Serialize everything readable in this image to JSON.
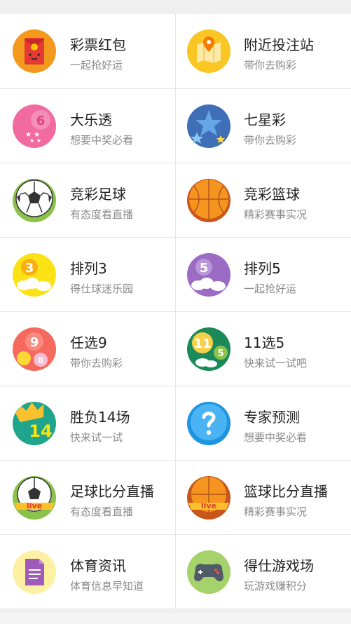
{
  "items": [
    {
      "title": "彩票红包",
      "subtitle": "一起抢好运",
      "icon": "red-envelope-icon"
    },
    {
      "title": "附近投注站",
      "subtitle": "带你去购彩",
      "icon": "map-pin-icon"
    },
    {
      "title": "大乐透",
      "subtitle": "想要中奖必看",
      "icon": "ball-6-icon"
    },
    {
      "title": "七星彩",
      "subtitle": "带你去购彩",
      "icon": "stars-ball-icon"
    },
    {
      "title": "竞彩足球",
      "subtitle": "有态度看直播",
      "icon": "soccer-ball-icon"
    },
    {
      "title": "竞彩篮球",
      "subtitle": "精彩赛事实况",
      "icon": "basketball-icon"
    },
    {
      "title": "排列3",
      "subtitle": "得仕球迷乐园",
      "icon": "number-3-cloud-icon"
    },
    {
      "title": "排列5",
      "subtitle": "一起抢好运",
      "icon": "number-5-cloud-icon"
    },
    {
      "title": "任选9",
      "subtitle": "带你去购彩",
      "icon": "number-9-balls-icon"
    },
    {
      "title": "11选5",
      "subtitle": "快来试一试吧",
      "icon": "ball-11-5-icon"
    },
    {
      "title": "胜负14场",
      "subtitle": "快来试一试",
      "icon": "crown-14-icon"
    },
    {
      "title": "专家预测",
      "subtitle": "想要中奖必看",
      "icon": "question-icon"
    },
    {
      "title": "足球比分直播",
      "subtitle": "有态度看直播",
      "icon": "soccer-live-icon"
    },
    {
      "title": "篮球比分直播",
      "subtitle": "精彩赛事实况",
      "icon": "basketball-live-icon"
    },
    {
      "title": "体育资讯",
      "subtitle": "体育信息早知道",
      "icon": "document-icon"
    },
    {
      "title": "得仕游戏场",
      "subtitle": "玩游戏赚积分",
      "icon": "gamepad-icon"
    }
  ],
  "icon_labels": {
    "ball_6": "6",
    "num_3": "3",
    "num_5": "5",
    "num_9": "9",
    "num_8": "8",
    "ball_11": "11",
    "ball_5": "5",
    "num_14": "14",
    "live": "live"
  }
}
